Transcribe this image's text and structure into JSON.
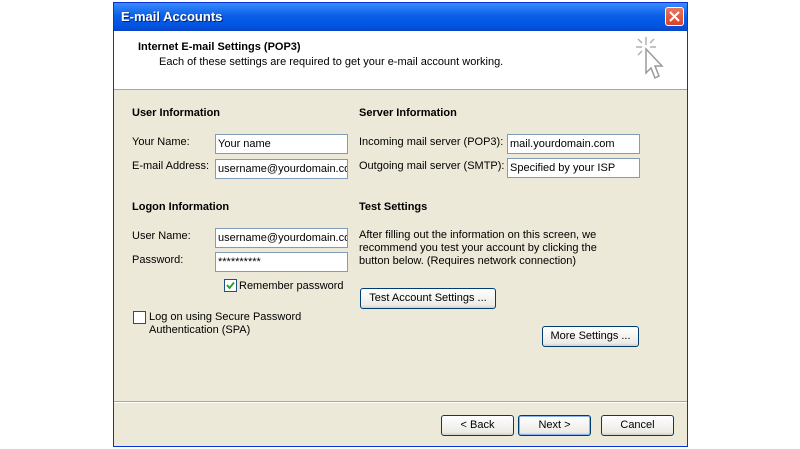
{
  "window": {
    "title": "E-mail Accounts",
    "close_icon": "close-icon"
  },
  "header": {
    "title": "Internet E-mail Settings (POP3)",
    "subtitle": "Each of these settings are required to get your e-mail account working."
  },
  "user_info": {
    "heading": "User Information",
    "name_label": "Your Name:",
    "name_value": "Your name",
    "email_label": "E-mail Address:",
    "email_value": "username@yourdomain.co"
  },
  "logon_info": {
    "heading": "Logon Information",
    "username_label": "User Name:",
    "username_value": "username@yourdomain.co",
    "password_label": "Password:",
    "password_value": "**********",
    "remember_label": "Remember password",
    "remember_checked": true,
    "spa_label_line1": "Log on using Secure Password",
    "spa_label_line2": "Authentication (SPA)",
    "spa_checked": false
  },
  "server_info": {
    "heading": "Server Information",
    "incoming_label": "Incoming mail server (POP3):",
    "incoming_value": "mail.yourdomain.com",
    "outgoing_label": "Outgoing mail server (SMTP):",
    "outgoing_value": "Specified by your ISP"
  },
  "test_settings": {
    "heading": "Test Settings",
    "description_line1": "After filling out the information on this screen, we",
    "description_line2": "recommend you test your account by clicking the",
    "description_line3": "button below. (Requires network connection)",
    "test_button": "Test Account Settings ..."
  },
  "more_settings_button": "More Settings ...",
  "footer": {
    "back": "< Back",
    "next": "Next >",
    "cancel": "Cancel"
  },
  "colors": {
    "titlebar": "#0054e3",
    "dialog_bg": "#ece9d8",
    "close_button": "#d9432b"
  }
}
